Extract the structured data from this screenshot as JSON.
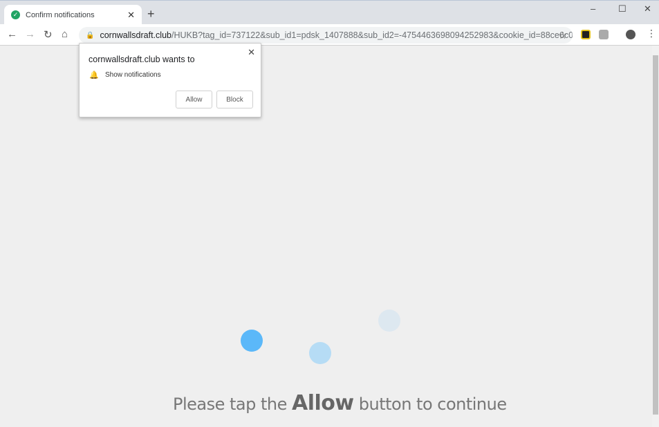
{
  "tab": {
    "title": "Confirm notifications",
    "favicon": "check-circle-icon"
  },
  "window": {
    "minimize": "–",
    "maximize": "☐",
    "close": "✕"
  },
  "address": {
    "host": "cornwallsdraft.club",
    "path": "/HUKB?tag_id=737122&sub_id1=pdsk_1407888&sub_id2=-4754463698094252983&cookie_id=88ce6c06-5..."
  },
  "popup": {
    "title": "cornwallsdraft.club wants to",
    "permission": "Show notifications",
    "allow": "Allow",
    "block": "Block"
  },
  "page": {
    "message_before": "Please tap the ",
    "message_bold": "Allow",
    "message_after": " button to continue"
  },
  "colors": {
    "dot1": "#5bb8f9",
    "dot2": "#b6dcf5",
    "dot3": "#dde8f0"
  }
}
